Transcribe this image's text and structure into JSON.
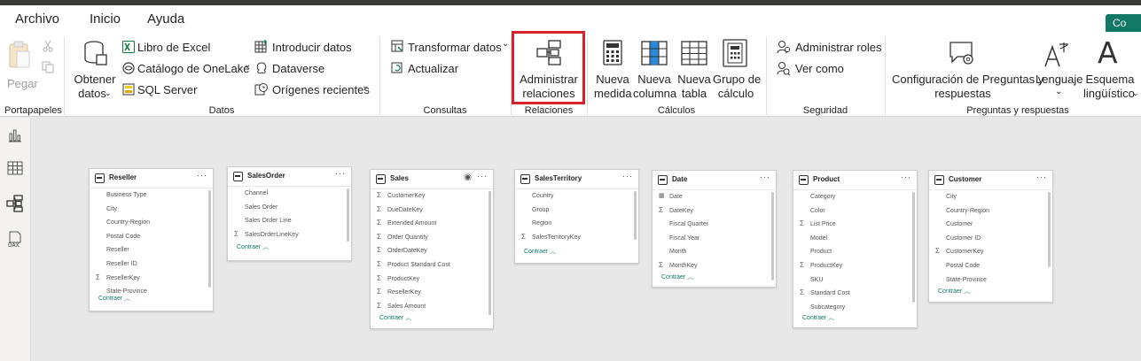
{
  "tabs": [
    "Archivo",
    "Inicio",
    "Ayuda"
  ],
  "share_label": "Co",
  "ribbon": {
    "paste_label": "Pegar",
    "get_data_label_1": "Obtener",
    "get_data_label_2": "datos",
    "excel_label": "Libro de Excel",
    "onelake_label": "Catálogo de OneLake",
    "sql_label": "SQL Server",
    "enter_data_label": "Introducir datos",
    "dataverse_label": "Dataverse",
    "recent_sources_label": "Orígenes recientes",
    "transform_label": "Transformar datos",
    "refresh_label": "Actualizar",
    "manage_rel_1": "Administrar",
    "manage_rel_2": "relaciones",
    "new_measure_1": "Nueva",
    "new_measure_2": "medida",
    "new_column_1": "Nueva",
    "new_column_2": "columna",
    "new_table_1": "Nueva",
    "new_table_2": "tabla",
    "calc_group_1": "Grupo de",
    "calc_group_2": "cálculo",
    "manage_roles": "Administrar roles",
    "view_as": "Ver como",
    "qa_config_1": "Configuración de Preguntas y",
    "qa_config_2": "respuestas",
    "language_label": "Lenguaje",
    "schema_1": "Esquema",
    "schema_2": "lingüístico",
    "groups": {
      "clipboard": "Portapapeles",
      "data": "Datos",
      "queries": "Consultas",
      "relations": "Relaciones",
      "calcs": "Cálculos",
      "security": "Seguridad",
      "qa": "Preguntas y respuestas"
    }
  },
  "collapse_label": "Contraer",
  "tables": [
    {
      "name": "Reseller",
      "fields": [
        {
          "n": "Business Type",
          "s": false
        },
        {
          "n": "City",
          "s": false
        },
        {
          "n": "Country-Region",
          "s": false
        },
        {
          "n": "Postal Code",
          "s": false
        },
        {
          "n": "Reseller",
          "s": false
        },
        {
          "n": "Reseller ID",
          "s": false
        },
        {
          "n": "ResellerKey",
          "s": true
        },
        {
          "n": "State-Province",
          "s": false
        }
      ]
    },
    {
      "name": "SalesOrder",
      "fields": [
        {
          "n": "Channel",
          "s": false
        },
        {
          "n": "Sales Order",
          "s": false
        },
        {
          "n": "Sales Order Line",
          "s": false
        },
        {
          "n": "SalesOrderLineKey",
          "s": true
        }
      ]
    },
    {
      "name": "Sales",
      "fields": [
        {
          "n": "CustomerKey",
          "s": true
        },
        {
          "n": "DueDateKey",
          "s": true
        },
        {
          "n": "Extended Amount",
          "s": true
        },
        {
          "n": "Order Quantity",
          "s": true
        },
        {
          "n": "OrderDateKey",
          "s": true
        },
        {
          "n": "Product Standard Cost",
          "s": true
        },
        {
          "n": "ProductKey",
          "s": true
        },
        {
          "n": "ResellerKey",
          "s": true
        },
        {
          "n": "Sales Amount",
          "s": true
        }
      ]
    },
    {
      "name": "SalesTerritory",
      "fields": [
        {
          "n": "Country",
          "s": false
        },
        {
          "n": "Group",
          "s": false
        },
        {
          "n": "Region",
          "s": false
        },
        {
          "n": "SalesTerritoryKey",
          "s": true
        }
      ]
    },
    {
      "name": "Date",
      "fields": [
        {
          "n": "Date",
          "s": false
        },
        {
          "n": "DateKey",
          "s": true
        },
        {
          "n": "Fiscal Quarter",
          "s": false
        },
        {
          "n": "Fiscal Year",
          "s": false
        },
        {
          "n": "Month",
          "s": false
        },
        {
          "n": "MonthKey",
          "s": true
        }
      ]
    },
    {
      "name": "Product",
      "fields": [
        {
          "n": "Category",
          "s": false
        },
        {
          "n": "Color",
          "s": false
        },
        {
          "n": "List Price",
          "s": true
        },
        {
          "n": "Model",
          "s": false
        },
        {
          "n": "Product",
          "s": false
        },
        {
          "n": "ProductKey",
          "s": true
        },
        {
          "n": "SKU",
          "s": false
        },
        {
          "n": "Standard Cost",
          "s": true
        },
        {
          "n": "Subcategory",
          "s": false
        }
      ]
    },
    {
      "name": "Customer",
      "fields": [
        {
          "n": "City",
          "s": false
        },
        {
          "n": "Country-Region",
          "s": false
        },
        {
          "n": "Customer",
          "s": false
        },
        {
          "n": "Customer ID",
          "s": false
        },
        {
          "n": "CustomerKey",
          "s": true
        },
        {
          "n": "Postal Code",
          "s": false
        },
        {
          "n": "State-Province",
          "s": false
        }
      ]
    }
  ]
}
